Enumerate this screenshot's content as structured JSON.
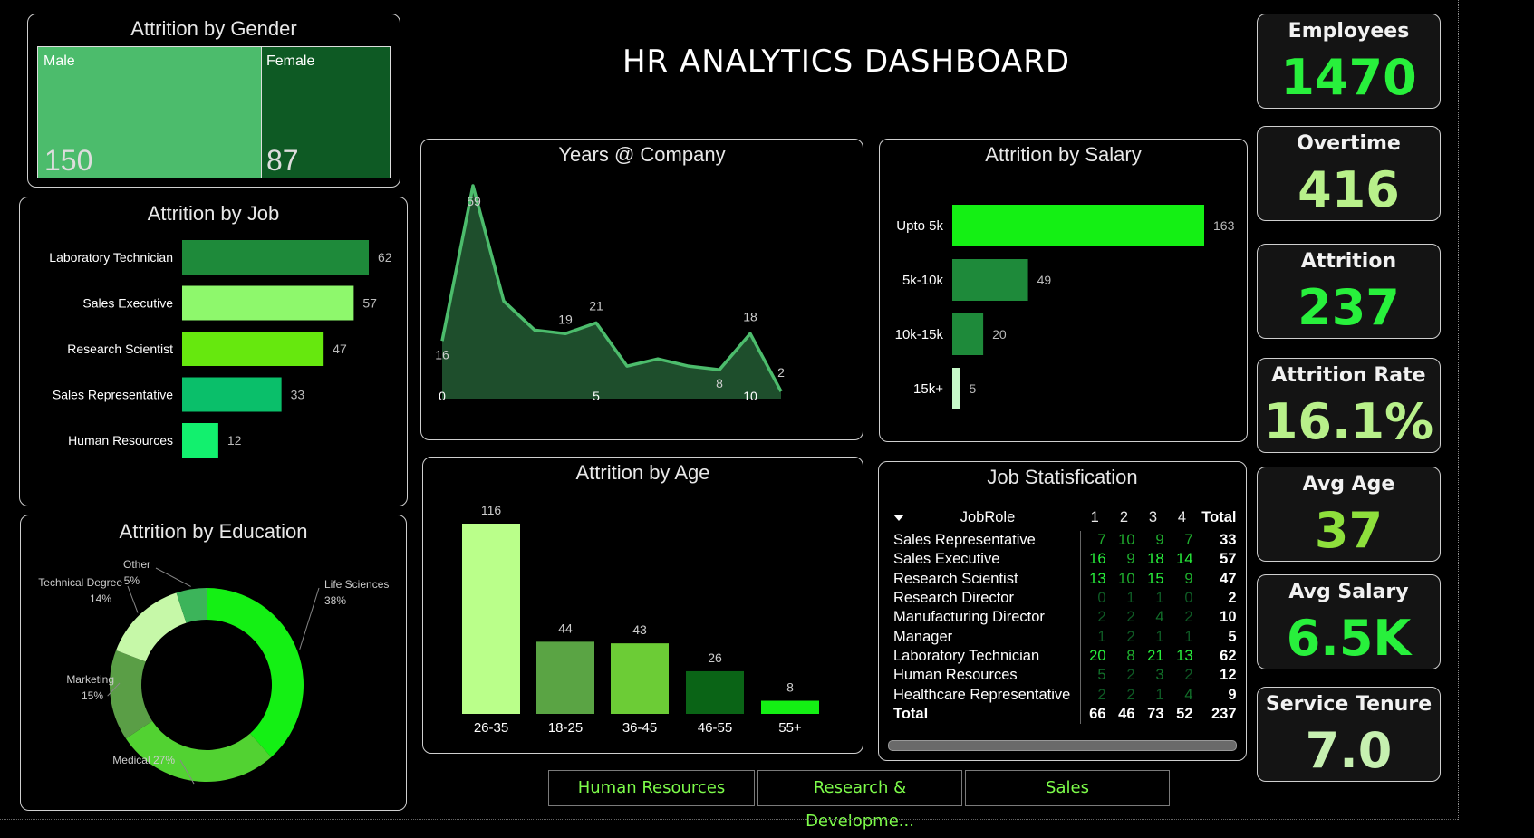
{
  "title": "HR ANALYTICS DASHBOARD",
  "gender": {
    "title": "Attrition by Gender",
    "items": [
      {
        "label": "Male",
        "value": "150",
        "color": "#4cbc6c"
      },
      {
        "label": "Female",
        "value": "87",
        "color": "#0e5a24"
      }
    ]
  },
  "job": {
    "title": "Attrition by Job",
    "items": [
      {
        "label": "Laboratory Technician",
        "value": 62,
        "color": "#1e8a3a"
      },
      {
        "label": "Sales Executive",
        "value": 57,
        "color": "#8ef86c"
      },
      {
        "label": "Research Scientist",
        "value": 47,
        "color": "#66e80e"
      },
      {
        "label": "Sales Representative",
        "value": 33,
        "color": "#0abf6a"
      },
      {
        "label": "Human Resources",
        "value": 12,
        "color": "#12f06e"
      }
    ]
  },
  "education": {
    "title": "Attrition by Education",
    "items": [
      {
        "label": "Life Sciences",
        "pct": "38%",
        "value": 38,
        "color": "#14f014"
      },
      {
        "label": "Medical",
        "pct": "27%",
        "value": 27,
        "color": "#52d232"
      },
      {
        "label": "Marketing",
        "pct": "15%",
        "value": 15,
        "color": "#5a9e46"
      },
      {
        "label": "Technical Degree",
        "pct": "14%",
        "value": 14,
        "color": "#c6f8a8"
      },
      {
        "label": "Other",
        "pct": "5%",
        "value": 5,
        "color": "#3cb45a"
      }
    ],
    "medical_label": "Medical 27%"
  },
  "years": {
    "title": "Years @ Company",
    "x_ticks": [
      "0",
      "5",
      "10"
    ]
  },
  "salary": {
    "title": "Attrition by Salary",
    "items": [
      {
        "label": "Upto 5k",
        "value": 163,
        "color": "#14f014"
      },
      {
        "label": "5k-10k",
        "value": 49,
        "color": "#1e8a3a"
      },
      {
        "label": "10k-15k",
        "value": 20,
        "color": "#1e8a3a"
      },
      {
        "label": "15k+",
        "value": 5,
        "color": "#c6f8c8"
      }
    ]
  },
  "age": {
    "title": "Attrition by Age",
    "items": [
      {
        "label": "26-35",
        "value": 116,
        "color": "#baff8a"
      },
      {
        "label": "18-25",
        "value": 44,
        "color": "#5aa444"
      },
      {
        "label": "36-45",
        "value": 43,
        "color": "#6ccc36"
      },
      {
        "label": "46-55",
        "value": 26,
        "color": "#0a6416"
      },
      {
        "label": "55+",
        "value": 8,
        "color": "#14f014"
      }
    ]
  },
  "satisfaction": {
    "title": "Job Statisfication",
    "headers": [
      "JobRole",
      "1",
      "2",
      "3",
      "4",
      "Total"
    ],
    "rows": [
      {
        "role": "Sales Representative",
        "v": [
          "7",
          "10",
          "9",
          "7"
        ],
        "total": "33"
      },
      {
        "role": "Sales Executive",
        "v": [
          "16",
          "9",
          "18",
          "14"
        ],
        "total": "57"
      },
      {
        "role": "Research Scientist",
        "v": [
          "13",
          "10",
          "15",
          "9"
        ],
        "total": "47"
      },
      {
        "role": "Research Director",
        "v": [
          "0",
          "1",
          "1",
          "0"
        ],
        "total": "2"
      },
      {
        "role": "Manufacturing Director",
        "v": [
          "2",
          "2",
          "4",
          "2"
        ],
        "total": "10"
      },
      {
        "role": "Manager",
        "v": [
          "1",
          "2",
          "1",
          "1"
        ],
        "total": "5"
      },
      {
        "role": "Laboratory Technician",
        "v": [
          "20",
          "8",
          "21",
          "13"
        ],
        "total": "62"
      },
      {
        "role": "Human Resources",
        "v": [
          "5",
          "2",
          "3",
          "2"
        ],
        "total": "12"
      },
      {
        "role": "Healthcare Representative",
        "v": [
          "2",
          "2",
          "1",
          "4"
        ],
        "total": "9"
      }
    ],
    "totals": {
      "role": "Total",
      "v": [
        "66",
        "46",
        "73",
        "52"
      ],
      "total": "237"
    }
  },
  "kpis": [
    {
      "label": "Employees",
      "value": "1470",
      "color": "#28f03c"
    },
    {
      "label": "Overtime",
      "value": "416",
      "color": "#b8f08a"
    },
    {
      "label": "Attrition",
      "value": "237",
      "color": "#28f03c"
    },
    {
      "label": "Attrition Rate",
      "value": "16.1%",
      "color": "#b8f08a"
    },
    {
      "label": "Avg Age",
      "value": "37",
      "color": "#8ee03c"
    },
    {
      "label": "Avg Salary",
      "value": "6.5K",
      "color": "#28f03c"
    },
    {
      "label": "Service Tenure",
      "value": "7.0",
      "color": "#c6f0b0"
    }
  ],
  "slicers": [
    "Human Resources",
    "Research & Developme...",
    "Sales"
  ],
  "chart_data": [
    {
      "type": "bar",
      "title": "Attrition by Job",
      "categories": [
        "Laboratory Technician",
        "Sales Executive",
        "Research Scientist",
        "Sales Representative",
        "Human Resources"
      ],
      "values": [
        62,
        57,
        47,
        33,
        12
      ]
    },
    {
      "type": "area",
      "title": "Years @ Company",
      "x": [
        0,
        1,
        2,
        3,
        4,
        5,
        6,
        7,
        8,
        9,
        10,
        11
      ],
      "values": [
        16,
        59,
        27,
        19,
        18,
        21,
        9,
        11,
        9,
        8,
        18,
        2
      ],
      "labels": {
        "0": "16",
        "1": "59",
        "4": "19",
        "5": "21",
        "9": "8",
        "10": "18",
        "11": "2"
      },
      "xlim": [
        0,
        11
      ]
    },
    {
      "type": "bar",
      "title": "Attrition by Salary",
      "categories": [
        "Upto 5k",
        "5k-10k",
        "10k-15k",
        "15k+"
      ],
      "values": [
        163,
        49,
        20,
        5
      ]
    },
    {
      "type": "bar",
      "title": "Attrition by Age",
      "categories": [
        "26-35",
        "18-25",
        "36-45",
        "46-55",
        "55+"
      ],
      "values": [
        116,
        44,
        43,
        26,
        8
      ]
    },
    {
      "type": "pie",
      "title": "Attrition by Education",
      "categories": [
        "Life Sciences",
        "Medical",
        "Marketing",
        "Technical Degree",
        "Other"
      ],
      "values": [
        38,
        27,
        15,
        14,
        5
      ]
    }
  ]
}
